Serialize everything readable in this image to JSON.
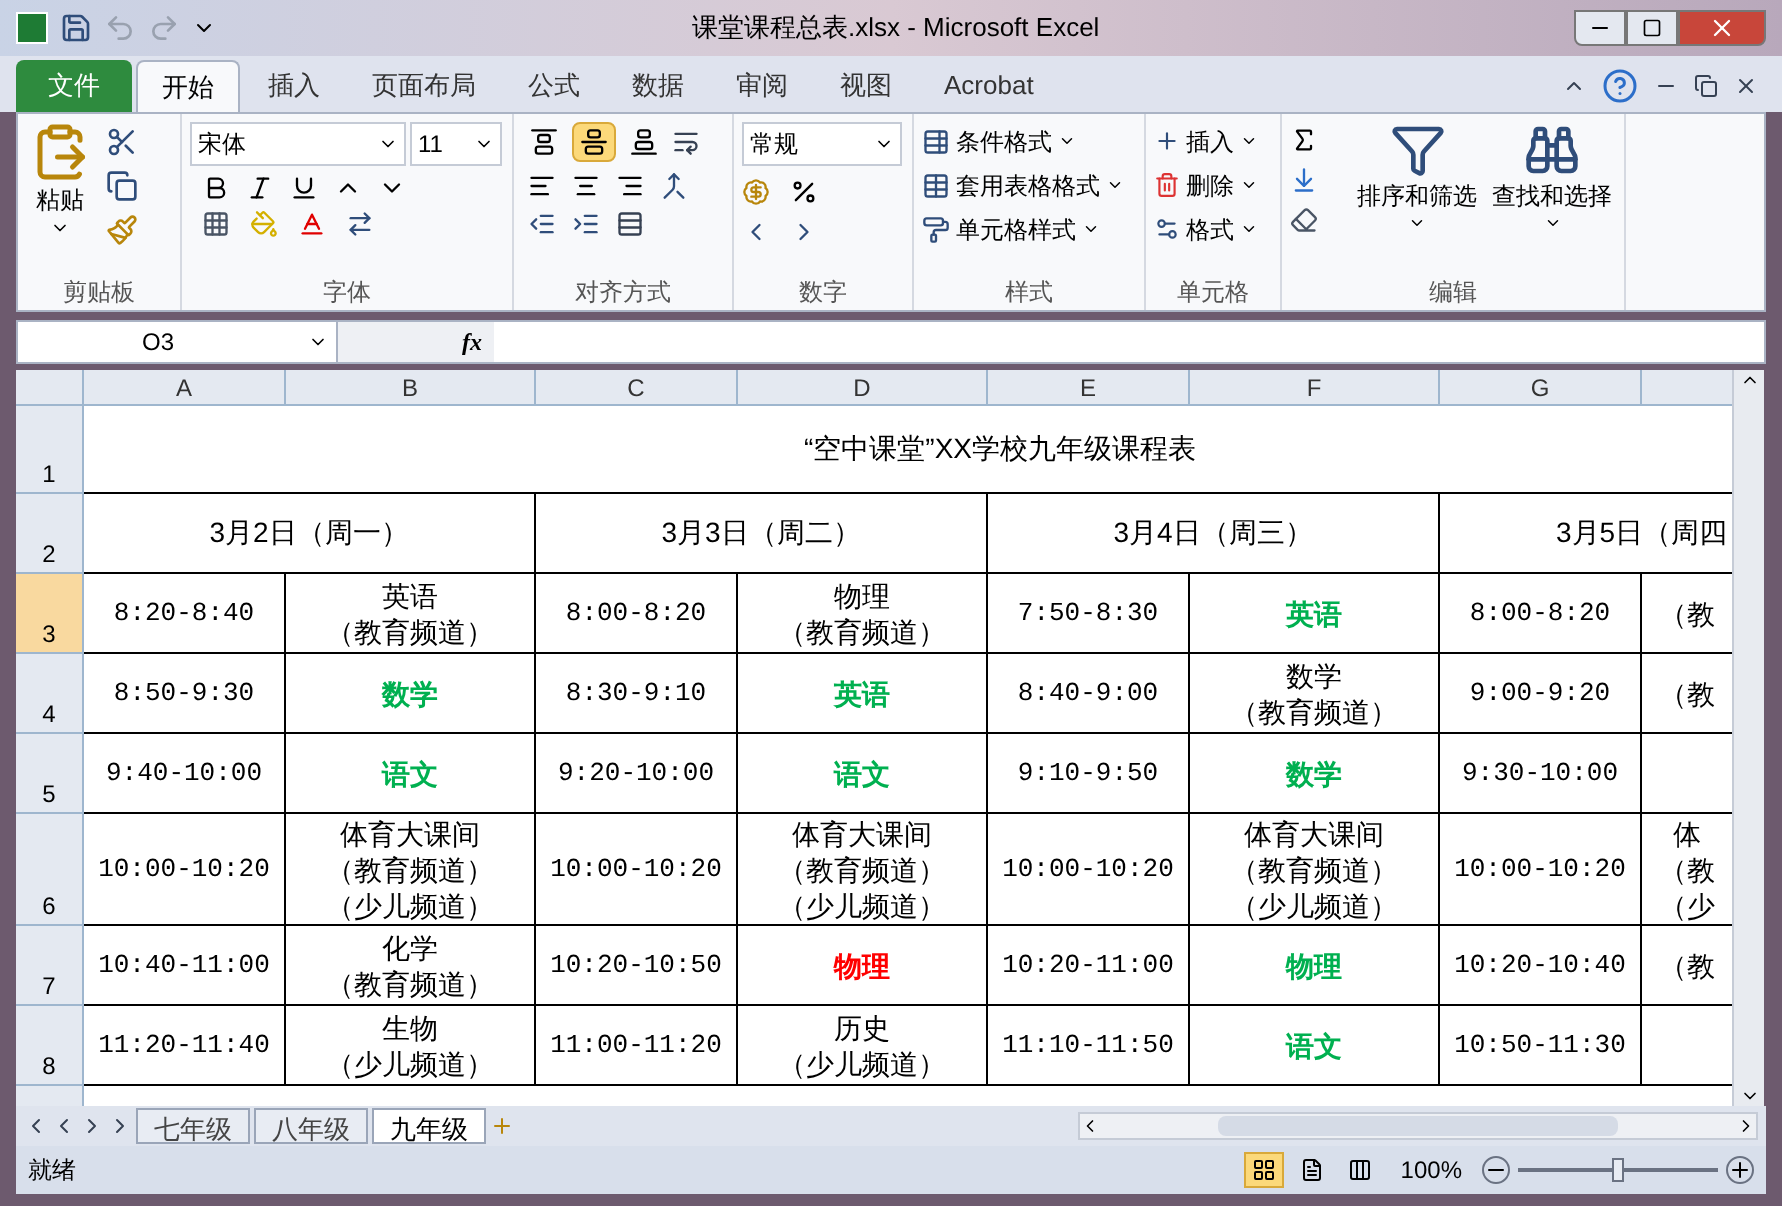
{
  "window": {
    "title": "课堂课程总表.xlsx - Microsoft Excel"
  },
  "ribbon_tabs": [
    {
      "label": "文件",
      "kind": "file",
      "selected": false
    },
    {
      "label": "开始",
      "kind": "tab",
      "selected": true
    },
    {
      "label": "插入",
      "kind": "tab",
      "selected": false
    },
    {
      "label": "页面布局",
      "kind": "tab",
      "selected": false
    },
    {
      "label": "公式",
      "kind": "tab",
      "selected": false
    },
    {
      "label": "数据",
      "kind": "tab",
      "selected": false
    },
    {
      "label": "审阅",
      "kind": "tab",
      "selected": false
    },
    {
      "label": "视图",
      "kind": "tab",
      "selected": false
    },
    {
      "label": "Acrobat",
      "kind": "tab",
      "selected": false
    }
  ],
  "ribbon": {
    "clipboard": {
      "label": "剪贴板",
      "paste": "粘贴"
    },
    "font": {
      "label": "字体",
      "font_name": "宋体",
      "font_size": "11"
    },
    "alignment": {
      "label": "对齐方式",
      "valign_buttons": [
        {
          "kind": "top",
          "selected": false
        },
        {
          "kind": "middle",
          "selected": true
        },
        {
          "kind": "bottom",
          "selected": false
        }
      ]
    },
    "number": {
      "label": "数字",
      "format": "常规"
    },
    "styles": {
      "label": "样式",
      "items": [
        "条件格式",
        "套用表格格式",
        "单元格样式"
      ]
    },
    "cells": {
      "label": "单元格",
      "items": [
        "插入",
        "删除",
        "格式"
      ]
    },
    "editing": {
      "label": "编辑",
      "items": [
        "排序和筛选",
        "查找和选择"
      ]
    }
  },
  "formula_bar": {
    "name_box": "O3",
    "function_label": "fx"
  },
  "columns": [
    "A",
    "B",
    "C",
    "D",
    "E",
    "F",
    "G"
  ],
  "sheet": {
    "title": "“空中课堂”XX学校九年级课程表",
    "dates": [
      "3月2日（周一）",
      "3月3日（周二）",
      "3月4日（周三）",
      "3月5日（周四"
    ],
    "rows": [
      {
        "number": "1",
        "selected": false
      },
      {
        "number": "2",
        "selected": false
      },
      {
        "number": "3",
        "selected": true,
        "cells": [
          {
            "lines": [
              "8:20-8:40"
            ]
          },
          {
            "lines": [
              "英语",
              "（教育频道）"
            ]
          },
          {
            "lines": [
              "8:00-8:20"
            ]
          },
          {
            "lines": [
              "物理",
              "（教育频道）"
            ]
          },
          {
            "lines": [
              "7:50-8:30"
            ]
          },
          {
            "lines": [
              "英语"
            ],
            "color": "#00b050"
          },
          {
            "lines": [
              "8:00-8:20"
            ]
          },
          {
            "lines": [
              "（教"
            ]
          }
        ]
      },
      {
        "number": "4",
        "selected": false,
        "cells": [
          {
            "lines": [
              "8:50-9:30"
            ]
          },
          {
            "lines": [
              "数学"
            ],
            "color": "#00b050"
          },
          {
            "lines": [
              "8:30-9:10"
            ]
          },
          {
            "lines": [
              "英语"
            ],
            "color": "#00b050"
          },
          {
            "lines": [
              "8:40-9:00"
            ]
          },
          {
            "lines": [
              "数学",
              "（教育频道）"
            ]
          },
          {
            "lines": [
              "9:00-9:20"
            ]
          },
          {
            "lines": [
              "（教"
            ]
          }
        ]
      },
      {
        "number": "5",
        "selected": false,
        "cells": [
          {
            "lines": [
              "9:40-10:00"
            ]
          },
          {
            "lines": [
              "语文"
            ],
            "color": "#00b050"
          },
          {
            "lines": [
              "9:20-10:00"
            ]
          },
          {
            "lines": [
              "语文"
            ],
            "color": "#00b050"
          },
          {
            "lines": [
              "9:10-9:50"
            ]
          },
          {
            "lines": [
              "数学"
            ],
            "color": "#00b050"
          },
          {
            "lines": [
              "9:30-10:00"
            ]
          },
          {}
        ]
      },
      {
        "number": "6",
        "selected": false,
        "cells": [
          {
            "lines": [
              "10:00-10:20"
            ]
          },
          {
            "lines": [
              "体育大课间",
              "（教育频道）",
              "（少儿频道）"
            ]
          },
          {
            "lines": [
              "10:00-10:20"
            ]
          },
          {
            "lines": [
              "体育大课间",
              "（教育频道）",
              "（少儿频道）"
            ]
          },
          {
            "lines": [
              "10:00-10:20"
            ]
          },
          {
            "lines": [
              "体育大课间",
              "（教育频道）",
              "（少儿频道）"
            ]
          },
          {
            "lines": [
              "10:00-10:20"
            ]
          },
          {
            "lines": [
              "体",
              "（教",
              "（少"
            ]
          }
        ]
      },
      {
        "number": "7",
        "selected": false,
        "cells": [
          {
            "lines": [
              "10:40-11:00"
            ]
          },
          {
            "lines": [
              "化学",
              "（教育频道）"
            ]
          },
          {
            "lines": [
              "10:20-10:50"
            ]
          },
          {
            "lines": [
              "物理"
            ],
            "color": "#ff0000"
          },
          {
            "lines": [
              "10:20-11:00"
            ]
          },
          {
            "lines": [
              "物理"
            ],
            "color": "#00b050"
          },
          {
            "lines": [
              "10:20-10:40"
            ]
          },
          {
            "lines": [
              "（教"
            ]
          }
        ]
      },
      {
        "number": "8",
        "selected": false,
        "cells": [
          {
            "lines": [
              "11:20-11:40"
            ]
          },
          {
            "lines": [
              "生物",
              "（少儿频道）"
            ]
          },
          {
            "lines": [
              "11:00-11:20"
            ]
          },
          {
            "lines": [
              "历史",
              "（少儿频道）"
            ]
          },
          {
            "lines": [
              "11:10-11:50"
            ]
          },
          {
            "lines": [
              "语文"
            ],
            "color": "#00b050"
          },
          {
            "lines": [
              "10:50-11:30"
            ]
          },
          {}
        ]
      }
    ]
  },
  "sheet_tabs": [
    {
      "label": "七年级",
      "selected": false
    },
    {
      "label": "八年级",
      "selected": false
    },
    {
      "label": "九年级",
      "selected": true
    }
  ],
  "status_bar": {
    "status": "就绪",
    "views": [
      {
        "kind": "normal",
        "selected": true
      },
      {
        "kind": "page_layout",
        "selected": false
      },
      {
        "kind": "page_break",
        "selected": false
      }
    ],
    "zoom": "100%",
    "level": 0.5
  }
}
